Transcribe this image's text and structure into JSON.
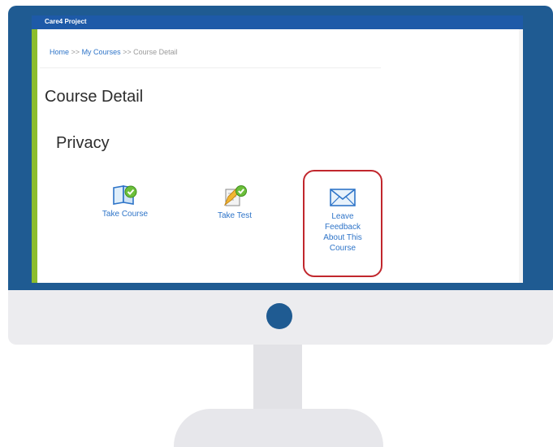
{
  "app": {
    "title": "Care4 Project"
  },
  "breadcrumb": {
    "home": "Home",
    "sep1": ">>",
    "courses": "My Courses",
    "sep2": ">>",
    "current": "Course Detail"
  },
  "page": {
    "title": "Course Detail",
    "section": "Privacy"
  },
  "actions": {
    "take_course": "Take Course",
    "take_test": "Take Test",
    "feedback": {
      "line1": "Leave",
      "line2": "Feedback",
      "line3": "About This",
      "line4": "Course"
    }
  },
  "colors": {
    "monitor_frame": "#1f5b92",
    "top_bar": "#1e5aa8",
    "accent_bar": "#8cbd2d",
    "link": "#2e74c8",
    "highlight": "#c1272d"
  },
  "icons": {
    "take_course": "book-check-icon",
    "take_test": "pencil-check-icon",
    "feedback": "envelope-icon"
  }
}
